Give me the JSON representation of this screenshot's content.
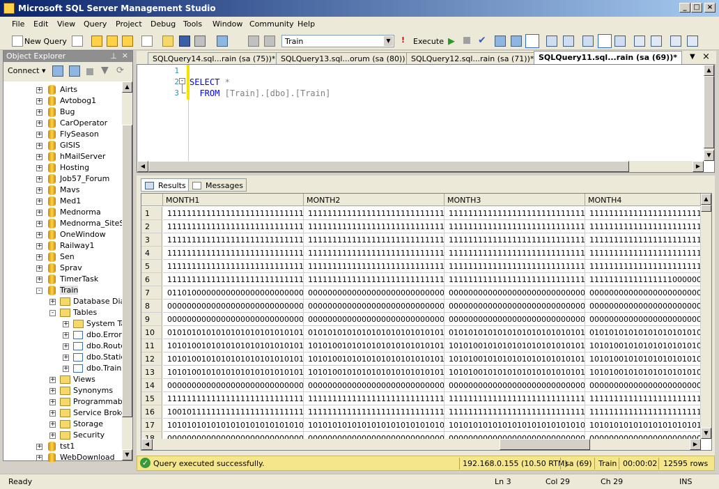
{
  "window": {
    "title": "Microsoft SQL Server Management Studio"
  },
  "menu": [
    "File",
    "Edit",
    "View",
    "Query",
    "Project",
    "Debug",
    "Tools",
    "Window",
    "Community",
    "Help"
  ],
  "toolbar": {
    "new_query": "New Query",
    "database": "Train",
    "execute": "Execute"
  },
  "object_explorer": {
    "title": "Object Explorer",
    "connect": "Connect",
    "items": [
      "Airts",
      "Avtobog1",
      "Bug",
      "CarOperator",
      "FlySeason",
      "GISIS",
      "hMailServer",
      "Hosting",
      "Job57_Forum",
      "Mavs",
      "Med1",
      "Mednorma",
      "Mednorma_SiteSta",
      "OneWindow",
      "Railway1",
      "Sen",
      "Sprav",
      "TimerTask",
      "Train",
      "Database Diag",
      "Tables",
      "System Ta",
      "dbo.Error",
      "dbo.Route",
      "dbo.Static",
      "dbo.Train",
      "Views",
      "Synonyms",
      "Programmabili",
      "Service Broker",
      "Storage",
      "Security",
      "tst1",
      "WebDownload"
    ]
  },
  "tabs": [
    "SQLQuery14.sql...rain (sa (75))*",
    "SQLQuery13.sql...orum (sa (80))",
    "SQLQuery12.sql...rain (sa (71))*",
    "SQLQuery11.sql...rain (sa (69))*"
  ],
  "editor": {
    "lines": [
      "1",
      "2",
      "3"
    ],
    "select": "SELECT",
    "star": "*",
    "from": "FROM",
    "obj": "[Train].[dbo].[Train]"
  },
  "results": {
    "tab_results": "Results",
    "tab_messages": "Messages",
    "columns": [
      "MONTH1",
      "MONTH2",
      "MONTH3",
      "MONTH4"
    ],
    "rows": [
      [
        "1",
        "1111111111111111111111111111111",
        "1111111111111111111111111111000",
        "1111111111111111111111111111111",
        "1111111111111111111111111111111"
      ],
      [
        "2",
        "1111111111111111111111111111111",
        "1111111111111111111111111111000",
        "1111111111111111111111111111111",
        "1111111111111111111111111111111"
      ],
      [
        "3",
        "1111111111111111111111111111111",
        "1111111111111111111111111111000",
        "1111111111111111111111111111111",
        "1111111111111111111111111111111"
      ],
      [
        "4",
        "1111111111111111111111111111111",
        "1111111111111111111111111111000",
        "1111111111111111111111111111111",
        "1111111111111111111111111111111"
      ],
      [
        "5",
        "1111111111111111111111111111111",
        "1111111111111111111111111111000",
        "1111111111111111111111111111111",
        "1111111111111111111111111111111"
      ],
      [
        "6",
        "1111111111111111111111111111111",
        "1111111111111111111111111111000",
        "1111111111111111111111111111111",
        "1111111111111111100000000000000"
      ],
      [
        "7",
        "0110100000000000000000000000000",
        "0000000000000000000000000000000",
        "0000000000000000000000000000000",
        "0000000000000000000000000000000"
      ],
      [
        "8",
        "0000000000000000000000000000000",
        "0000000000000000000000000000000",
        "0000000000000000000000000000000",
        "0000000000000000000000000000000"
      ],
      [
        "9",
        "0000000000000000000000000000000",
        "0000000000000000000000000000000",
        "0000000000000000000000000000000",
        "0000000000000000000000000000000"
      ],
      [
        "10",
        "0101010101010101010101010101010",
        "0101010101010101010101010101010",
        "0101010101010101010101010101010",
        "0101010101010101010101010101010"
      ],
      [
        "11",
        "1010100101010101010101010101010",
        "1010100101010101010101010101000",
        "1010100101010101010101010101010",
        "1010100101010101010101010101010"
      ],
      [
        "12",
        "1010100101010101010101010101010",
        "1010100101010101010101010101000",
        "1010100101010101010101010101010",
        "1010100101010101010101010101010"
      ],
      [
        "13",
        "1010100101010101010101010101010",
        "1010100101010101010101010101000",
        "1010100101010101010101010101010",
        "1010100101010101010101010101010"
      ],
      [
        "14",
        "0000000000000000000000000000000",
        "0000000000000000000000000000000",
        "0000000000000000000000000000000",
        "0000000000000000000000000000000"
      ],
      [
        "15",
        "1111111111111111111111111111111",
        "1111111111111111111111111111000",
        "1111111111111111111111111111111",
        "1111111111111111111111111111111"
      ],
      [
        "16",
        "1001011111111111111111111111111",
        "1111111111111111111111111111000",
        "1111111111111111111111111111111",
        "1111111111111111111111111111111"
      ],
      [
        "17",
        "1010101010101010101010101010101",
        "1010101010101010101010101010000",
        "1010101010101010101010101010101",
        "1010101010101010101010101010101"
      ],
      [
        "18",
        "0000000000000000000000000000000",
        "0000000000000000000000000000000",
        "0000000000000000000000000000000",
        "0000000000000000000000000000000"
      ]
    ]
  },
  "query_status": {
    "message": "Query executed successfully.",
    "server": "192.168.0.155 (10.50 RTM)",
    "user": "sa (69)",
    "database": "Train",
    "elapsed": "00:00:02",
    "rows": "12595 rows"
  },
  "status_bar": {
    "ready": "Ready",
    "ln": "Ln 3",
    "col": "Col 29",
    "ch": "Ch 29",
    "ins": "INS"
  }
}
